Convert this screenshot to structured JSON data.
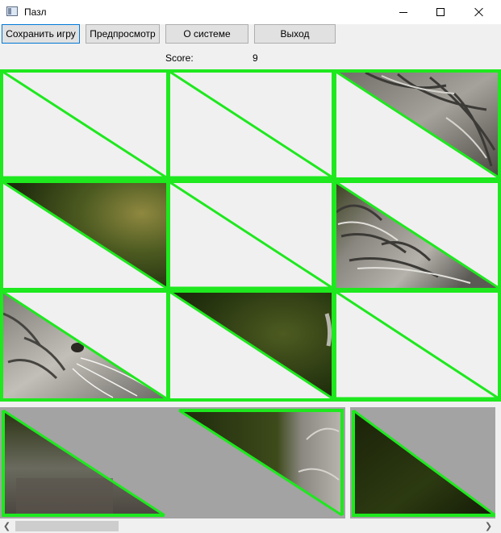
{
  "window": {
    "title": "Пазл",
    "icon": "app-window-icon"
  },
  "toolbar": {
    "save_label": "Сохранить игру",
    "preview_label": "Предпросмотр",
    "about_label": "О системе",
    "exit_label": "Выход"
  },
  "score": {
    "label": "Score:",
    "value": "9"
  },
  "colors": {
    "outline": "#1ee81e",
    "empty_cell": "#f0f0f0",
    "tray_gray": "#a3a3a3",
    "cat_gray": "#8a8a86",
    "cat_dark": "#3c3a36",
    "grass_dark": "#1d2a0c",
    "grass_mid": "#4d5b21",
    "grass_light": "#8f8840",
    "fur_light": "#d6d4cf"
  },
  "icons": {
    "minimize": "minimize-icon",
    "maximize": "maximize-icon",
    "close": "close-icon",
    "scroll_left": "chevron-left-icon",
    "scroll_right": "chevron-right-icon"
  }
}
